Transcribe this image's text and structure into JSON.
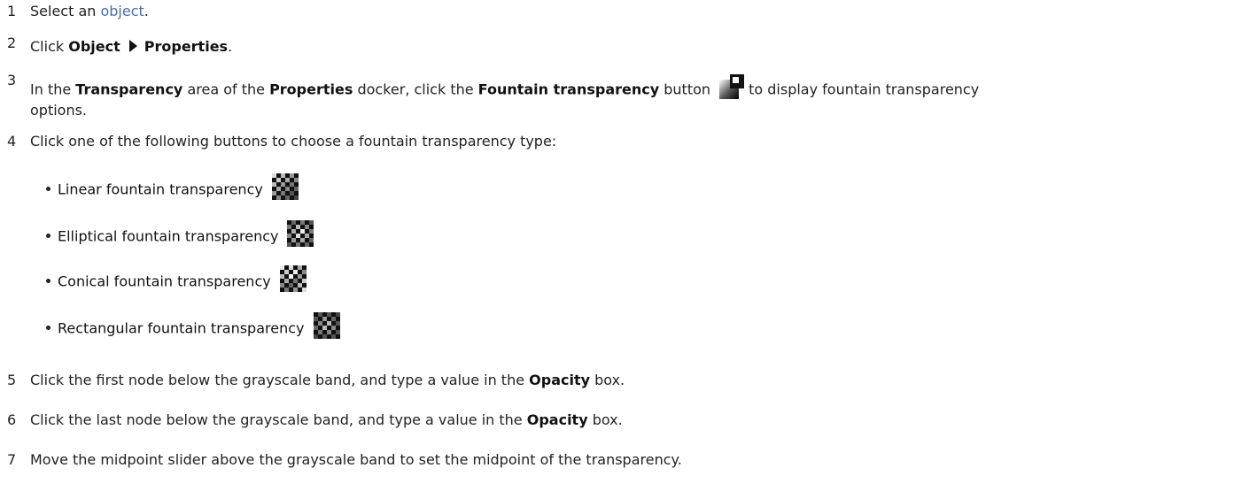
{
  "steps": [
    {
      "num": "1",
      "pre": "Select an ",
      "link": "object",
      "post": "."
    },
    {
      "num": "2",
      "pre": "Click ",
      "b1": "Object",
      "b2": "Properties",
      "post": "."
    },
    {
      "num": "3",
      "t1": "In the ",
      "b1": "Transparency",
      "t2": " area of the ",
      "b2": "Properties",
      "t3": " docker, click the ",
      "b3": "Fountain transparency",
      "t4": " button",
      "t5": " to display fountain transparency",
      "line2": "options."
    },
    {
      "num": "4",
      "text": "Click one of the following buttons to choose a fountain transparency type:"
    },
    {
      "num": "5",
      "t1": "Click the first node below the grayscale band, and type a value in the ",
      "b1": "Opacity",
      "t2": " box."
    },
    {
      "num": "6",
      "t1": "Click the last node below the grayscale band, and type a value in the ",
      "b1": "Opacity",
      "t2": " box."
    },
    {
      "num": "7",
      "text": "Move the midpoint slider above the grayscale band to set the midpoint of the transparency."
    }
  ],
  "types": [
    {
      "label": "Linear fountain transparency",
      "icon": "linear-transparency-icon"
    },
    {
      "label": "Elliptical fountain transparency",
      "icon": "elliptical-transparency-icon"
    },
    {
      "label": "Conical fountain transparency",
      "icon": "conical-transparency-icon"
    },
    {
      "label": "Rectangular fountain transparency",
      "icon": "rectangular-transparency-icon"
    }
  ],
  "colors": {
    "text": "#222222",
    "link": "#4a6fa5"
  }
}
